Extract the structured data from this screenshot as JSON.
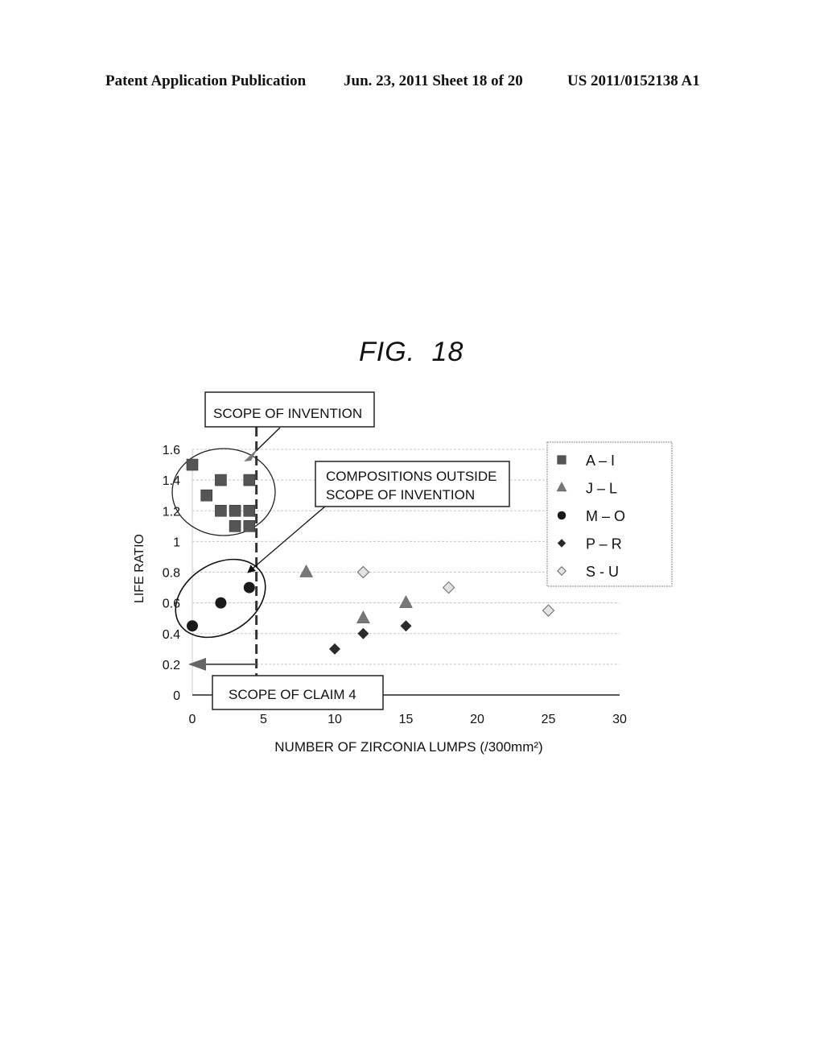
{
  "header": {
    "left": "Patent Application Publication",
    "center": "Jun. 23, 2011  Sheet 18 of 20",
    "right": "US 2011/0152138 A1"
  },
  "figure_label": "FIG. 18",
  "annotations": {
    "scope_of_invention": "SCOPE  OF  INVENTION",
    "outside_line1": "COMPOSITIONS  OUTSIDE",
    "outside_line2": "SCOPE  OF  INVENTION",
    "scope_of_claim": "SCOPE  OF  CLAIM  4",
    "scope_boundary_x": 4.5,
    "claim_arrow_y": 0.2
  },
  "colors": {
    "square": "#555555",
    "triangle": "#777777",
    "circle": "#1a1a1a",
    "diamond": "#2a2a2a",
    "open_diamond": "#e4e4e4"
  },
  "chart_data": {
    "type": "scatter",
    "title": "FIG. 18",
    "xlabel": "NUMBER  OF  ZIRCONIA  LUMPS  (/300mm²)",
    "ylabel": "LIFE  RATIO",
    "xlim": [
      0,
      30
    ],
    "ylim": [
      0,
      1.6
    ],
    "xticks": [
      "0",
      "5",
      "10",
      "15",
      "20",
      "25",
      "30"
    ],
    "xtick_values": [
      0,
      5,
      10,
      15,
      20,
      25,
      30
    ],
    "yticks": [
      "0",
      "0.2",
      "0.4",
      "0.6",
      "0.8",
      "1",
      "1.2",
      "1.4",
      "1.6"
    ],
    "ytick_values": [
      0,
      0.2,
      0.4,
      0.6,
      0.8,
      1.0,
      1.2,
      1.4,
      1.6
    ],
    "grid": true,
    "legend_position": "top-right",
    "series": [
      {
        "name": "A – I",
        "marker": "square",
        "points": [
          [
            0,
            1.5
          ],
          [
            1,
            1.3
          ],
          [
            2,
            1.4
          ],
          [
            4,
            1.4
          ],
          [
            2,
            1.2
          ],
          [
            3,
            1.2
          ],
          [
            4,
            1.2
          ],
          [
            3,
            1.1
          ],
          [
            4,
            1.1
          ]
        ]
      },
      {
        "name": "J – L",
        "marker": "triangle",
        "points": [
          [
            8,
            0.8
          ],
          [
            12,
            0.5
          ],
          [
            15,
            0.6
          ]
        ]
      },
      {
        "name": "M – O",
        "marker": "circle",
        "points": [
          [
            0,
            0.45
          ],
          [
            2,
            0.6
          ],
          [
            4,
            0.7
          ]
        ]
      },
      {
        "name": "P – R",
        "marker": "diamond",
        "points": [
          [
            10,
            0.3
          ],
          [
            12,
            0.4
          ],
          [
            15,
            0.45
          ]
        ]
      },
      {
        "name": "S - U",
        "marker": "open-diamond",
        "points": [
          [
            12,
            0.8
          ],
          [
            18,
            0.7
          ],
          [
            25,
            0.55
          ]
        ]
      }
    ]
  }
}
